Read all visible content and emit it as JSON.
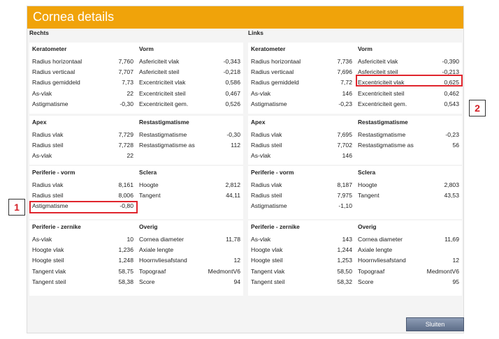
{
  "title": "Cornea details",
  "sides": [
    {
      "label": "Rechts",
      "sections": [
        {
          "title": "Keratometer",
          "rows": [
            {
              "label": "Radius horizontaal",
              "value": "7,760"
            },
            {
              "label": "Radius verticaal",
              "value": "7,707"
            },
            {
              "label": "Radius gemiddeld",
              "value": "7,73"
            },
            {
              "label": "As-vlak",
              "value": "22"
            },
            {
              "label": "Astigmatisme",
              "value": "-0,30"
            }
          ]
        },
        {
          "title": "Vorm",
          "rows": [
            {
              "label": "Asfericiteit vlak",
              "value": "-0,343"
            },
            {
              "label": "Asfericiteit steil",
              "value": "-0,218"
            },
            {
              "label": "Excentriciteit vlak",
              "value": "0,586"
            },
            {
              "label": "Excentriciteit steil",
              "value": "0,467"
            },
            {
              "label": "Excentriciteit gem.",
              "value": "0,526"
            }
          ]
        },
        {
          "title": "Apex",
          "rows": [
            {
              "label": "Radius vlak",
              "value": "7,729"
            },
            {
              "label": "Radius steil",
              "value": "7,728"
            },
            {
              "label": "As-vlak",
              "value": "22"
            }
          ]
        },
        {
          "title": "Restastigmatisme",
          "rows": [
            {
              "label": "Restastigmatisme",
              "value": "-0,30"
            },
            {
              "label": "Restastigmatisme as",
              "value": "112"
            }
          ]
        },
        {
          "title": "Periferie - vorm",
          "rows": [
            {
              "label": "Radius vlak",
              "value": "8,161"
            },
            {
              "label": "Radius steil",
              "value": "8,006"
            },
            {
              "label": "Astigmatisme",
              "value": "-0,80"
            }
          ]
        },
        {
          "title": "Sclera",
          "rows": [
            {
              "label": "Hoogte",
              "value": "2,812"
            },
            {
              "label": "Tangent",
              "value": "44,11"
            }
          ]
        },
        {
          "title": "Periferie - zernike",
          "rows": [
            {
              "label": "As-vlak",
              "value": "10"
            },
            {
              "label": "Hoogte vlak",
              "value": "1,236"
            },
            {
              "label": "Hoogte steil",
              "value": "1,248"
            },
            {
              "label": "Tangent vlak",
              "value": "58,75"
            },
            {
              "label": "Tangent steil",
              "value": "58,38"
            }
          ]
        },
        {
          "title": "Overig",
          "rows": [
            {
              "label": "Cornea diameter",
              "value": "11,78"
            },
            {
              "label": "Axiale lengte",
              "value": ""
            },
            {
              "label": "Hoornvliesafstand",
              "value": "12"
            },
            {
              "label": "Topograaf",
              "value": "MedmontV6"
            },
            {
              "label": "Score",
              "value": "94"
            }
          ]
        }
      ]
    },
    {
      "label": "Links",
      "sections": [
        {
          "title": "Keratometer",
          "rows": [
            {
              "label": "Radius horizontaal",
              "value": "7,736"
            },
            {
              "label": "Radius verticaal",
              "value": "7,696"
            },
            {
              "label": "Radius gemiddeld",
              "value": "7,72"
            },
            {
              "label": "As-vlak",
              "value": "146"
            },
            {
              "label": "Astigmatisme",
              "value": "-0,23"
            }
          ]
        },
        {
          "title": "Vorm",
          "rows": [
            {
              "label": "Asfericiteit vlak",
              "value": "-0,390"
            },
            {
              "label": "Asfericiteit steil",
              "value": "-0,213"
            },
            {
              "label": "Excentriciteit vlak",
              "value": "0,625"
            },
            {
              "label": "Excentriciteit steil",
              "value": "0,462"
            },
            {
              "label": "Excentriciteit gem.",
              "value": "0,543"
            }
          ]
        },
        {
          "title": "Apex",
          "rows": [
            {
              "label": "Radius vlak",
              "value": "7,695"
            },
            {
              "label": "Radius steil",
              "value": "7,702"
            },
            {
              "label": "As-vlak",
              "value": "146"
            }
          ]
        },
        {
          "title": "Restastigmatisme",
          "rows": [
            {
              "label": "Restastigmatisme",
              "value": "-0,23"
            },
            {
              "label": "Restastigmatisme as",
              "value": "56"
            }
          ]
        },
        {
          "title": "Periferie - vorm",
          "rows": [
            {
              "label": "Radius vlak",
              "value": "8,187"
            },
            {
              "label": "Radius steil",
              "value": "7,975"
            },
            {
              "label": "Astigmatisme",
              "value": "-1,10"
            }
          ]
        },
        {
          "title": "Sclera",
          "rows": [
            {
              "label": "Hoogte",
              "value": "2,803"
            },
            {
              "label": "Tangent",
              "value": "43,53"
            }
          ]
        },
        {
          "title": "Periferie - zernike",
          "rows": [
            {
              "label": "As-vlak",
              "value": "143"
            },
            {
              "label": "Hoogte vlak",
              "value": "1,244"
            },
            {
              "label": "Hoogte steil",
              "value": "1,253"
            },
            {
              "label": "Tangent vlak",
              "value": "58,50"
            },
            {
              "label": "Tangent steil",
              "value": "58,32"
            }
          ]
        },
        {
          "title": "Overig",
          "rows": [
            {
              "label": "Cornea diameter",
              "value": "11,69"
            },
            {
              "label": "Axiale lengte",
              "value": ""
            },
            {
              "label": "Hoornvliesafstand",
              "value": "12"
            },
            {
              "label": "Topograaf",
              "value": "MedmontV6"
            },
            {
              "label": "Score",
              "value": "95"
            }
          ]
        }
      ]
    }
  ],
  "annotations": [
    {
      "number": "1"
    },
    {
      "number": "2"
    }
  ],
  "close_button": "Sluiten",
  "colors": {
    "titlebar": "#f0a30a",
    "callout": "#e0252d",
    "badge_text": "#d41f26"
  }
}
